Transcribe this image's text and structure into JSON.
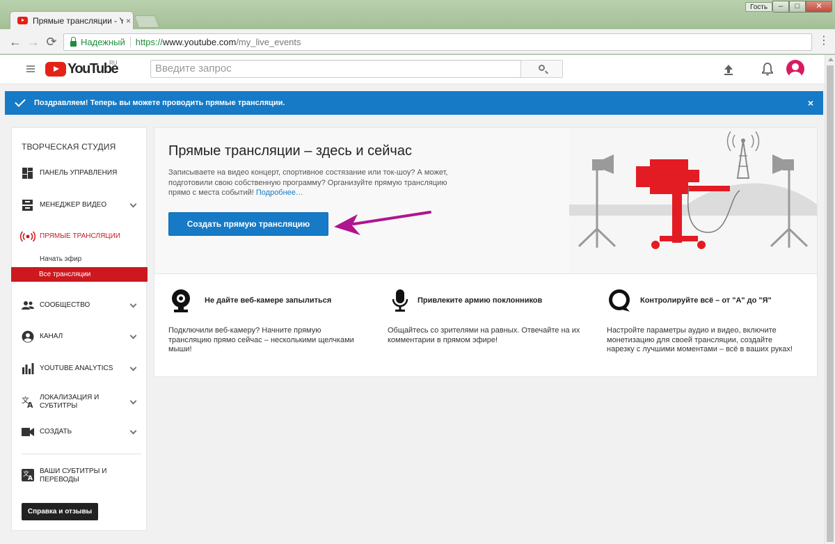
{
  "browser": {
    "tab_title": "Прямые трансляции - Y",
    "tab_close": "×",
    "guest_label": "Гость",
    "window_buttons": {
      "minimize": "–",
      "maximize": "□",
      "close": "✕"
    },
    "nav": {
      "back": "←",
      "forward": "→",
      "reload": "⟳"
    },
    "secure_label": "Надежный",
    "url_scheme": "https://",
    "url_host": "www.youtube.com",
    "url_path": "/my_live_events",
    "menu": "⋮"
  },
  "header": {
    "logo_text": "YouTube",
    "region": "RU",
    "search_placeholder": "Введите запрос"
  },
  "banner": {
    "text": "Поздравляем! Теперь вы можете проводить прямые трансляции.",
    "close": "×",
    "color": "#167ac6"
  },
  "sidebar": {
    "title": "ТВОРЧЕСКАЯ СТУДИЯ",
    "items": [
      {
        "label": "ПАНЕЛЬ УПРАВЛЕНИЯ",
        "icon": "dashboard-icon"
      },
      {
        "label": "МЕНЕДЖЕР ВИДЕО",
        "icon": "video-manager-icon",
        "expandable": true
      },
      {
        "label": "ПРЯМЫЕ ТРАНСЛЯЦИИ",
        "icon": "live-icon",
        "active": true
      },
      {
        "label": "СООБЩЕСТВО",
        "icon": "community-icon",
        "expandable": true
      },
      {
        "label": "КАНАЛ",
        "icon": "channel-icon",
        "expandable": true
      },
      {
        "label": "YOUTUBE ANALYTICS",
        "icon": "analytics-icon",
        "expandable": true
      },
      {
        "label": "ЛОКАЛИЗАЦИЯ И СУБТИТРЫ",
        "icon": "translate-icon",
        "expandable": true
      },
      {
        "label": "СОЗДАТЬ",
        "icon": "camera-icon",
        "expandable": true
      },
      {
        "label": "ВАШИ СУБТИТРЫ И ПЕРЕВОДЫ",
        "icon": "subtitles-icon"
      }
    ],
    "live_sub_items": [
      {
        "label": "Начать эфир",
        "active": false
      },
      {
        "label": "Все трансляции",
        "active": true
      }
    ],
    "help_button": "Справка и отзывы",
    "accent_color": "#cc181e"
  },
  "main": {
    "title": "Прямые трансляции – здесь и сейчас",
    "description": "Записываете на видео концерт, спортивное состязание или ток-шоу? А может, подготовили свою собственную программу? Организуйте прямую трансляцию прямо с места событий!",
    "more_link": "Подробнее…",
    "create_button": "Создать прямую трансляцию",
    "annotation_arrow_color": "#b0148f",
    "features": [
      {
        "icon": "webcam-icon",
        "title": "Не дайте веб-камере запылиться",
        "text": "Подключили веб-камеру? Начните прямую трансляцию прямо сейчас – несколькими щелчками мыши!"
      },
      {
        "icon": "microphone-icon",
        "title": "Привлеките армию поклонников",
        "text": "Общайтесь со зрителями на равных. Отвечайте на их комментарии в прямом эфире!"
      },
      {
        "icon": "chat-bubble-icon",
        "title": "Контролируйте всё – от \"А\" до \"Я\"",
        "text": "Настройте параметры аудио и видео, включите монетизацию для своей трансляции, создайте нарезку с лучшими моментами – всё в ваших руках!"
      }
    ]
  }
}
